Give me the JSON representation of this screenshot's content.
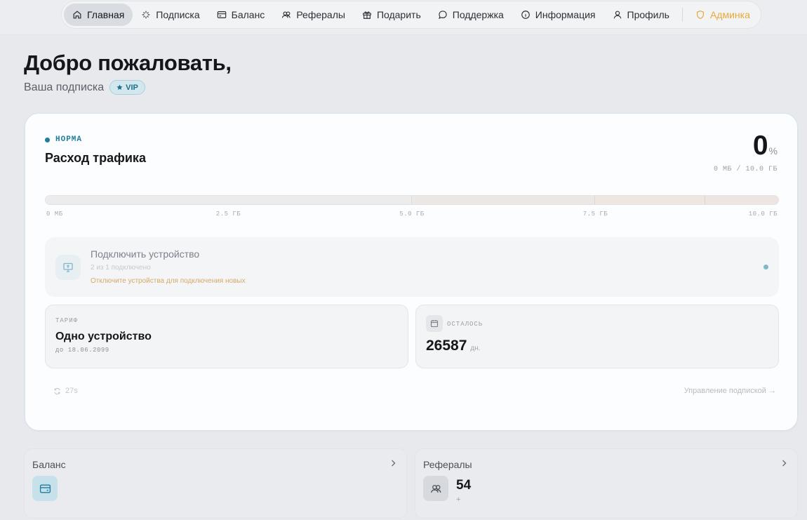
{
  "nav": {
    "items": [
      {
        "label": "Главная",
        "icon": "home-icon"
      },
      {
        "label": "Подписка",
        "icon": "sparkle-icon"
      },
      {
        "label": "Баланс",
        "icon": "wallet-icon"
      },
      {
        "label": "Рефералы",
        "icon": "users-icon"
      },
      {
        "label": "Подарить",
        "icon": "gift-icon"
      },
      {
        "label": "Поддержка",
        "icon": "chat-icon"
      },
      {
        "label": "Информация",
        "icon": "info-icon"
      },
      {
        "label": "Профиль",
        "icon": "user-icon"
      }
    ],
    "admin": {
      "label": "Админка",
      "icon": "shield-icon"
    },
    "active_index": 0
  },
  "header": {
    "welcome": "Добро пожаловать,",
    "subscription_label": "Ваша подписка",
    "badge": "VIP"
  },
  "traffic": {
    "status": "НОРМА",
    "title": "Расход трафика",
    "percent": "0",
    "percent_unit": "%",
    "usage_text": "0 МБ / 10.0 ГБ",
    "used_fraction": 0,
    "ticks": [
      "0 МБ",
      "2.5 ГБ",
      "5.0 ГБ",
      "7.5 ГБ",
      "10.0 ГБ"
    ]
  },
  "device": {
    "title": "Подключить устройство",
    "subtitle": "2 из 1 подключено",
    "warning": "Отключите устройства для подключения новых"
  },
  "tariff": {
    "label": "ТАРИФ",
    "name": "Одно устройство",
    "until": "до 18.06.2099"
  },
  "remaining": {
    "label": "ОСТАЛОСЬ",
    "days": "26587",
    "unit": "дн."
  },
  "footer": {
    "refresh": "27s",
    "manage": "Управление подпиской →"
  },
  "balance_card": {
    "title": "Баланс"
  },
  "referrals_card": {
    "title": "Рефералы",
    "count": "54",
    "sub": "+"
  },
  "colors": {
    "accent": "#1d7d9d",
    "admin": "#e9a93a",
    "warning": "#d7a86a"
  }
}
